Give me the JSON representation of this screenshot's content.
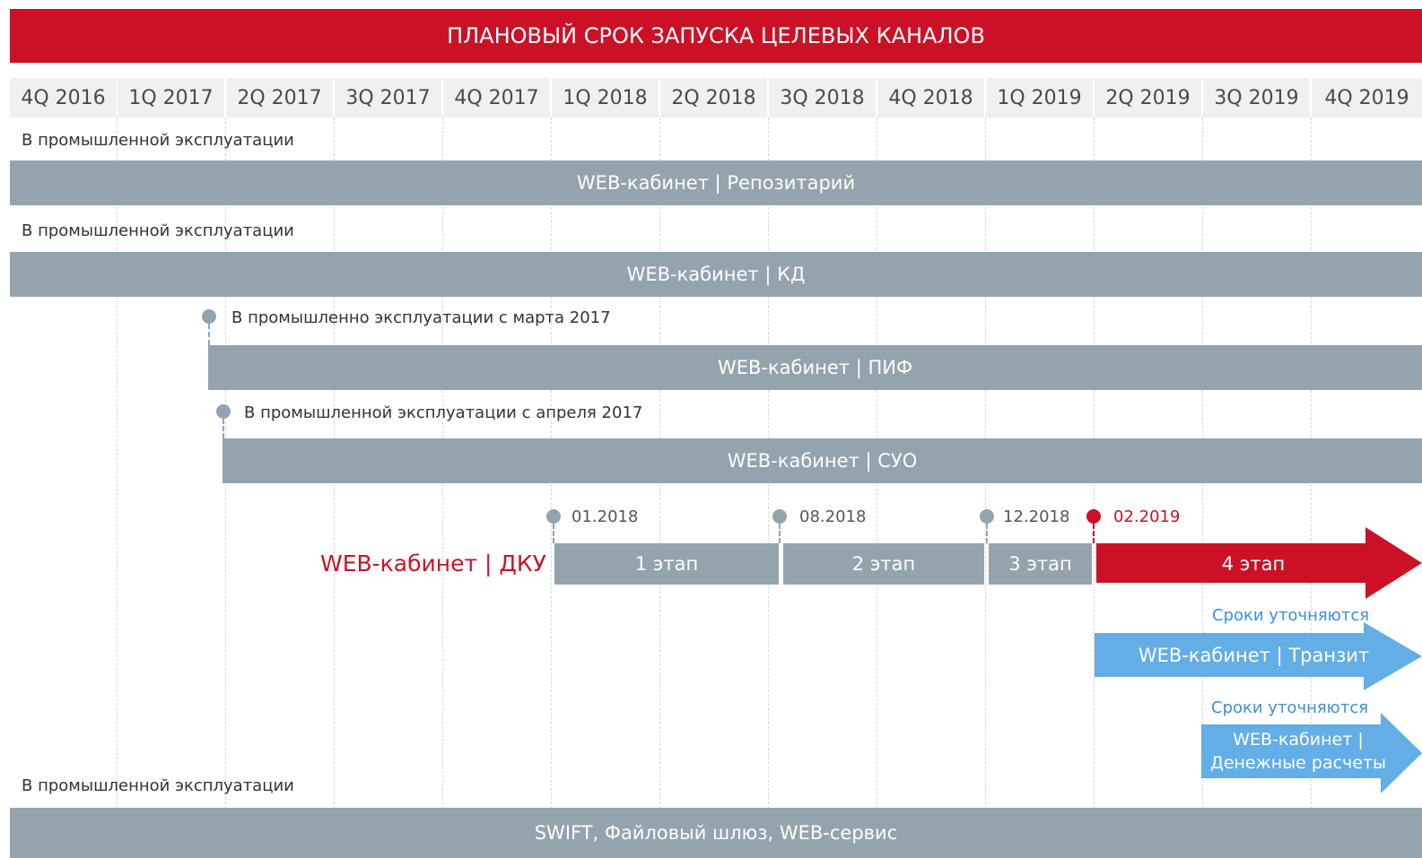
{
  "header": {
    "title": "ПЛАНОВЫЙ СРОК ЗАПУСКА ЦЕЛЕВЫХ КАНАЛОВ"
  },
  "quarters": [
    "4Q 2016",
    "1Q 2017",
    "2Q 2017",
    "3Q 2017",
    "4Q 2017",
    "1Q 2018",
    "2Q 2018",
    "3Q 2018",
    "4Q 2018",
    "1Q 2019",
    "2Q 2019",
    "3Q 2019",
    "4Q 2019"
  ],
  "rows": {
    "repo": {
      "note": "В промышленной эксплуатации",
      "bar": "WEB-кабинет | Репозитарий"
    },
    "kd": {
      "note": "В промышленной эксплуатации",
      "bar": "WEB-кабинет | КД"
    },
    "pif": {
      "note": "В промышленно эксплуатации с  марта 2017",
      "bar": "WEB-кабинет | ПИФ"
    },
    "suo": {
      "note": "В промышленной эксплуатации с апреля 2017",
      "bar": "WEB-кабинет | СУО"
    },
    "dku": {
      "label": "WEB-кабинет | ДКУ",
      "dates": [
        "01.2018",
        "08.2018",
        "12.2018",
        "02.2019"
      ],
      "stages": [
        "1 этап",
        "2 этап",
        "3 этап",
        "4 этап"
      ]
    },
    "tranzit": {
      "note": "Сроки уточняются",
      "bar": "WEB-кабинет | Транзит"
    },
    "money": {
      "note": "Сроки уточняются",
      "bar_line1": "WEB-кабинет |",
      "bar_line2": "Денежные расчеты"
    },
    "swift": {
      "note": "В промышленной эксплуатации",
      "bar": "SWIFT, Файловый шлюз, WEB-сервис"
    }
  },
  "colors": {
    "red": "#cc1126",
    "gray": "#93a4ae",
    "blue": "#63aee6",
    "blue_text": "#3d8fd6"
  }
}
